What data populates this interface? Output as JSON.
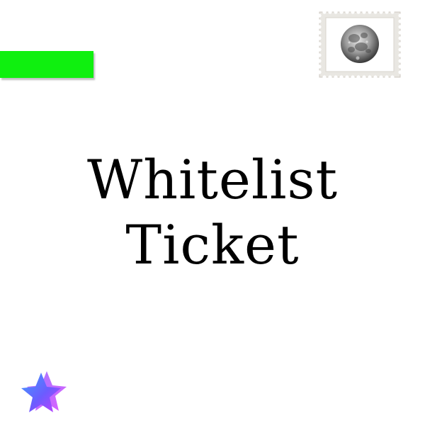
{
  "ticket": {
    "title_line1": "Whitelist",
    "title_line2": "Ticket"
  },
  "decorations": {
    "bar_color": "#0ff00f",
    "stamp_icon": "moon-postage-stamp-icon",
    "star_icon": "gradient-star-icon",
    "star_gradient": [
      "#3fa0ff",
      "#6b5cff",
      "#c83cff"
    ]
  }
}
